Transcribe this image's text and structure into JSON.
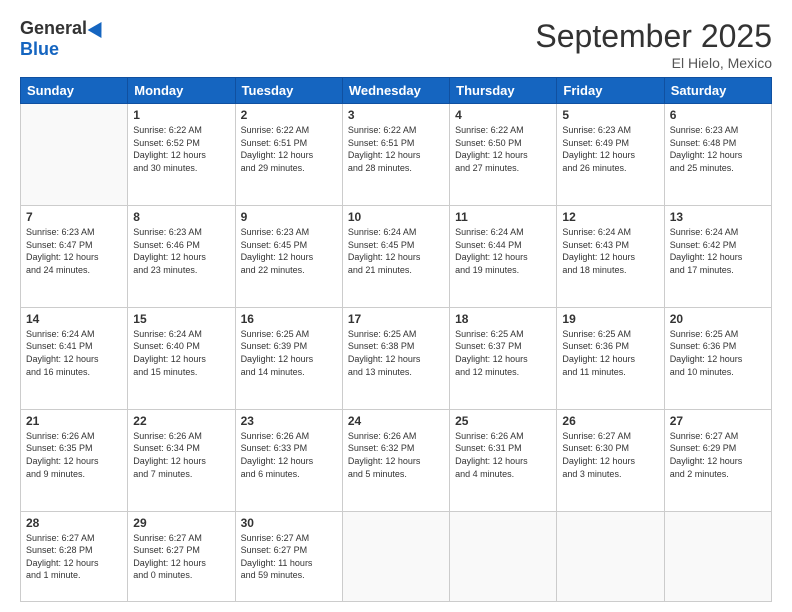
{
  "header": {
    "logo_general": "General",
    "logo_blue": "Blue",
    "month_title": "September 2025",
    "location": "El Hielo, Mexico"
  },
  "days_of_week": [
    "Sunday",
    "Monday",
    "Tuesday",
    "Wednesday",
    "Thursday",
    "Friday",
    "Saturday"
  ],
  "weeks": [
    [
      {
        "day": "",
        "info": ""
      },
      {
        "day": "1",
        "info": "Sunrise: 6:22 AM\nSunset: 6:52 PM\nDaylight: 12 hours\nand 30 minutes."
      },
      {
        "day": "2",
        "info": "Sunrise: 6:22 AM\nSunset: 6:51 PM\nDaylight: 12 hours\nand 29 minutes."
      },
      {
        "day": "3",
        "info": "Sunrise: 6:22 AM\nSunset: 6:51 PM\nDaylight: 12 hours\nand 28 minutes."
      },
      {
        "day": "4",
        "info": "Sunrise: 6:22 AM\nSunset: 6:50 PM\nDaylight: 12 hours\nand 27 minutes."
      },
      {
        "day": "5",
        "info": "Sunrise: 6:23 AM\nSunset: 6:49 PM\nDaylight: 12 hours\nand 26 minutes."
      },
      {
        "day": "6",
        "info": "Sunrise: 6:23 AM\nSunset: 6:48 PM\nDaylight: 12 hours\nand 25 minutes."
      }
    ],
    [
      {
        "day": "7",
        "info": "Sunrise: 6:23 AM\nSunset: 6:47 PM\nDaylight: 12 hours\nand 24 minutes."
      },
      {
        "day": "8",
        "info": "Sunrise: 6:23 AM\nSunset: 6:46 PM\nDaylight: 12 hours\nand 23 minutes."
      },
      {
        "day": "9",
        "info": "Sunrise: 6:23 AM\nSunset: 6:45 PM\nDaylight: 12 hours\nand 22 minutes."
      },
      {
        "day": "10",
        "info": "Sunrise: 6:24 AM\nSunset: 6:45 PM\nDaylight: 12 hours\nand 21 minutes."
      },
      {
        "day": "11",
        "info": "Sunrise: 6:24 AM\nSunset: 6:44 PM\nDaylight: 12 hours\nand 19 minutes."
      },
      {
        "day": "12",
        "info": "Sunrise: 6:24 AM\nSunset: 6:43 PM\nDaylight: 12 hours\nand 18 minutes."
      },
      {
        "day": "13",
        "info": "Sunrise: 6:24 AM\nSunset: 6:42 PM\nDaylight: 12 hours\nand 17 minutes."
      }
    ],
    [
      {
        "day": "14",
        "info": "Sunrise: 6:24 AM\nSunset: 6:41 PM\nDaylight: 12 hours\nand 16 minutes."
      },
      {
        "day": "15",
        "info": "Sunrise: 6:24 AM\nSunset: 6:40 PM\nDaylight: 12 hours\nand 15 minutes."
      },
      {
        "day": "16",
        "info": "Sunrise: 6:25 AM\nSunset: 6:39 PM\nDaylight: 12 hours\nand 14 minutes."
      },
      {
        "day": "17",
        "info": "Sunrise: 6:25 AM\nSunset: 6:38 PM\nDaylight: 12 hours\nand 13 minutes."
      },
      {
        "day": "18",
        "info": "Sunrise: 6:25 AM\nSunset: 6:37 PM\nDaylight: 12 hours\nand 12 minutes."
      },
      {
        "day": "19",
        "info": "Sunrise: 6:25 AM\nSunset: 6:36 PM\nDaylight: 12 hours\nand 11 minutes."
      },
      {
        "day": "20",
        "info": "Sunrise: 6:25 AM\nSunset: 6:36 PM\nDaylight: 12 hours\nand 10 minutes."
      }
    ],
    [
      {
        "day": "21",
        "info": "Sunrise: 6:26 AM\nSunset: 6:35 PM\nDaylight: 12 hours\nand 9 minutes."
      },
      {
        "day": "22",
        "info": "Sunrise: 6:26 AM\nSunset: 6:34 PM\nDaylight: 12 hours\nand 7 minutes."
      },
      {
        "day": "23",
        "info": "Sunrise: 6:26 AM\nSunset: 6:33 PM\nDaylight: 12 hours\nand 6 minutes."
      },
      {
        "day": "24",
        "info": "Sunrise: 6:26 AM\nSunset: 6:32 PM\nDaylight: 12 hours\nand 5 minutes."
      },
      {
        "day": "25",
        "info": "Sunrise: 6:26 AM\nSunset: 6:31 PM\nDaylight: 12 hours\nand 4 minutes."
      },
      {
        "day": "26",
        "info": "Sunrise: 6:27 AM\nSunset: 6:30 PM\nDaylight: 12 hours\nand 3 minutes."
      },
      {
        "day": "27",
        "info": "Sunrise: 6:27 AM\nSunset: 6:29 PM\nDaylight: 12 hours\nand 2 minutes."
      }
    ],
    [
      {
        "day": "28",
        "info": "Sunrise: 6:27 AM\nSunset: 6:28 PM\nDaylight: 12 hours\nand 1 minute."
      },
      {
        "day": "29",
        "info": "Sunrise: 6:27 AM\nSunset: 6:27 PM\nDaylight: 12 hours\nand 0 minutes."
      },
      {
        "day": "30",
        "info": "Sunrise: 6:27 AM\nSunset: 6:27 PM\nDaylight: 11 hours\nand 59 minutes."
      },
      {
        "day": "",
        "info": ""
      },
      {
        "day": "",
        "info": ""
      },
      {
        "day": "",
        "info": ""
      },
      {
        "day": "",
        "info": ""
      }
    ]
  ]
}
